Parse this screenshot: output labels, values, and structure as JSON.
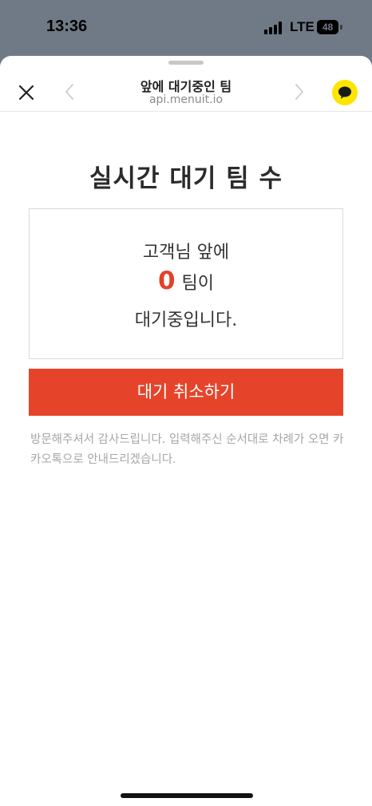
{
  "status": {
    "time": "13:36",
    "network": "LTE",
    "battery": "48",
    "battery_level": 0.48
  },
  "nav": {
    "title": "앞에 대기중인 팀",
    "url": "api.menuit.io",
    "icons": [
      "close-icon",
      "back-chevron-icon",
      "forward-chevron-icon",
      "kakaotalk-icon"
    ]
  },
  "main": {
    "heading": "실시간 대기 팀 수",
    "card": {
      "line1": "고객님 앞에",
      "count": "0",
      "line2_suffix": "팀이",
      "line3": "대기중입니다."
    },
    "cancel_button": "대기 취소하기",
    "notice": "방문해주셔서 감사드립니다. 입력해주신 순서대로 차례가 오면 카카오톡으로 안내드리겠습니다."
  },
  "colors": {
    "accent": "#e5442b",
    "count": "#e4412b",
    "kakao": "#fee500",
    "status_bar_bg": "#6f7a86"
  }
}
